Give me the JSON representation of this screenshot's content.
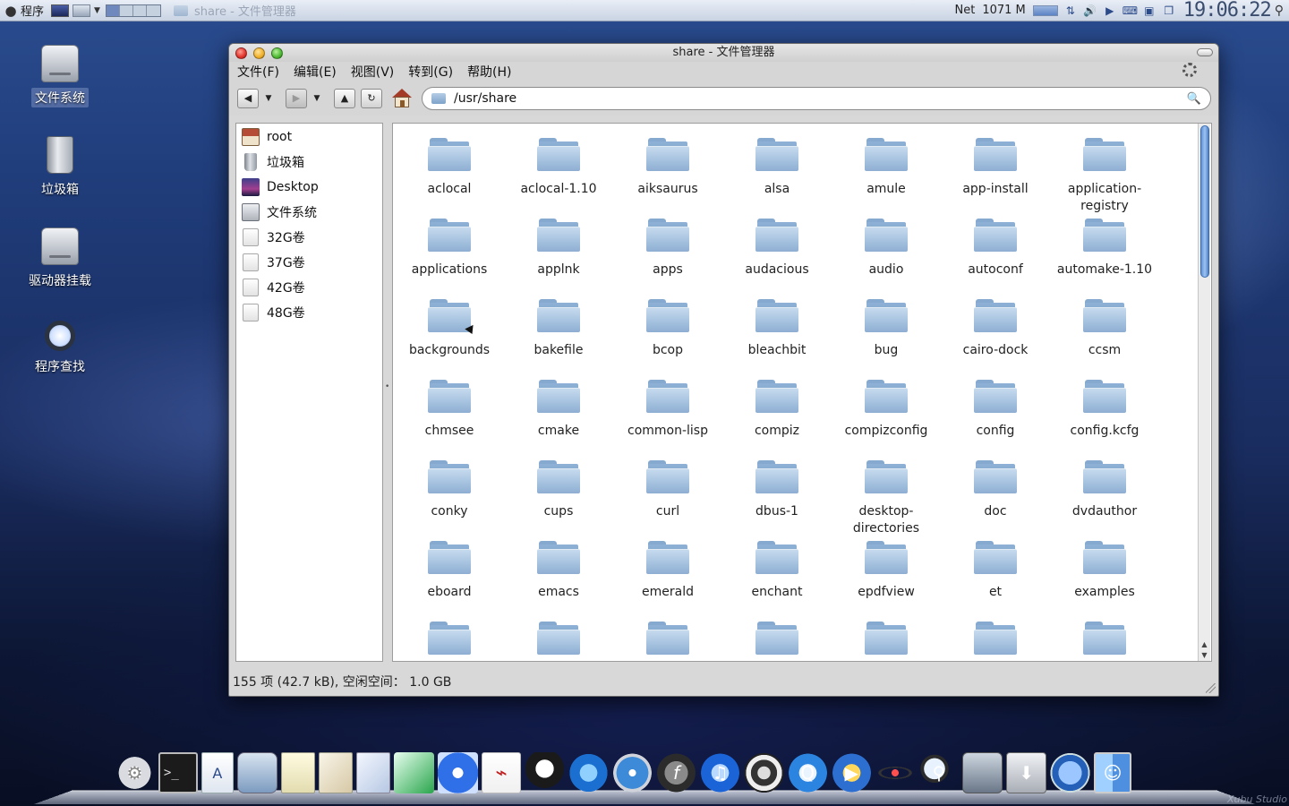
{
  "top_panel": {
    "menu_label": "程序",
    "task_title": "share - 文件管理器",
    "net_label": "Net",
    "memory": "1071 M",
    "clock": "19:06:22"
  },
  "desktop_icons": [
    {
      "label": "文件系统",
      "icon": "hard-drive-icon"
    },
    {
      "label": "垃圾箱",
      "icon": "trash-icon"
    },
    {
      "label": "驱动器挂载",
      "icon": "drive-mount-icon"
    },
    {
      "label": "程序查找",
      "icon": "app-finder-icon"
    }
  ],
  "window": {
    "title": "share - 文件管理器",
    "menu": [
      "文件(F)",
      "编辑(E)",
      "视图(V)",
      "转到(G)",
      "帮助(H)"
    ],
    "location": "/usr/share",
    "sidebar": [
      {
        "label": "root",
        "icon": "home-icon"
      },
      {
        "label": "垃圾箱",
        "icon": "trash-icon"
      },
      {
        "label": "Desktop",
        "icon": "desktop-icon"
      },
      {
        "label": "文件系统",
        "icon": "disk-icon"
      },
      {
        "label": "32G卷",
        "icon": "volume-icon"
      },
      {
        "label": "37G卷",
        "icon": "volume-icon"
      },
      {
        "label": "42G卷",
        "icon": "volume-icon"
      },
      {
        "label": "48G卷",
        "icon": "volume-icon"
      }
    ],
    "folders": [
      [
        "aclocal",
        "aclocal-1.10",
        "aiksaurus",
        "alsa",
        "amule",
        "app-install",
        "application-\nregistry"
      ],
      [
        "applications",
        "applnk",
        "apps",
        "audacious",
        "audio",
        "autoconf",
        "automake-1.10"
      ],
      [
        "backgrounds",
        "bakefile",
        "bcop",
        "bleachbit",
        "bug",
        "cairo-dock",
        "ccsm"
      ],
      [
        "chmsee",
        "cmake",
        "common-lisp",
        "compiz",
        "compizconfig",
        "config",
        "config.kcfg"
      ],
      [
        "conky",
        "cups",
        "curl",
        "dbus-1",
        "desktop-\ndirectories",
        "doc",
        "dvdauthor"
      ],
      [
        "eboard",
        "emacs",
        "emerald",
        "enchant",
        "epdfview",
        "et",
        "examples"
      ],
      [
        "",
        "",
        "",
        "",
        "",
        "",
        ""
      ]
    ],
    "status": "155 项 (42.7 kB), 空闲空间： 1.0 GB"
  },
  "dock": {
    "items": [
      "settings-icon",
      "terminal-icon",
      "text-editor-icon",
      "preview-icon",
      "notes-icon",
      "draw-icon",
      "chart-icon",
      "feather-icon",
      "flower-icon",
      "pdf-icon",
      "qq-icon",
      "ie-icon",
      "safari-icon",
      "flash-icon",
      "itunes-icon",
      "ipod-icon",
      "quicktime-icon",
      "player-icon",
      "atom-icon",
      "search-icon",
      "camera-icon",
      "disk-utility-icon",
      "globe-icon",
      "finder-icon"
    ],
    "watermark": "Xubu Studio"
  }
}
